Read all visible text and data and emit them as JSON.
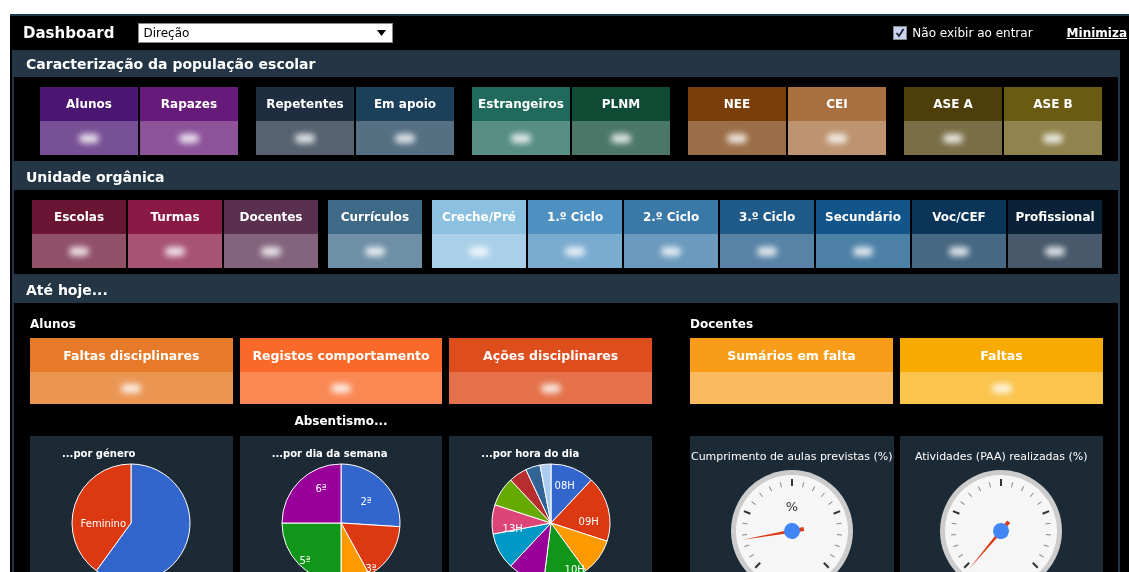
{
  "header": {
    "title": "Dashboard",
    "role_select": {
      "value": "Direção"
    },
    "hide_on_start": {
      "label": "Não exibir ao entrar",
      "checked": true
    },
    "minimize_link": "Minimiza"
  },
  "overview": {
    "title": "Caracterização da população escolar",
    "groups": [
      [
        {
          "label": "Alunos",
          "color": "#4b1572"
        },
        {
          "label": "Rapazes",
          "color": "#661a7a"
        }
      ],
      [
        {
          "label": "Repetentes",
          "color": "#1e2d40"
        },
        {
          "label": "Em apoio",
          "color": "#1c3f5a"
        }
      ],
      [
        {
          "label": "Estrangeiros",
          "color": "#1f6a5c"
        },
        {
          "label": "PLNM",
          "color": "#0f4a35"
        }
      ],
      [
        {
          "label": "NEE",
          "color": "#7a3e0a"
        },
        {
          "label": "CEI",
          "color": "#a87040"
        }
      ],
      [
        {
          "label": "ASE A",
          "color": "#4e3e0a"
        },
        {
          "label": "ASE B",
          "color": "#6b5a12"
        }
      ]
    ]
  },
  "units": {
    "title": "Unidade orgânica",
    "groups": [
      [
        {
          "label": "Escolas",
          "color": "#6b1535"
        },
        {
          "label": "Turmas",
          "color": "#8a1a45"
        },
        {
          "label": "Docentes",
          "color": "#5a3050"
        }
      ],
      [
        {
          "label": "Currículos",
          "color": "#3e6a88"
        }
      ],
      [
        {
          "label": "Creche/Pré",
          "color": "#8cc0e0"
        },
        {
          "label": "1.º Ciclo",
          "color": "#4e90c0"
        },
        {
          "label": "2.º Ciclo",
          "color": "#3a78a8"
        },
        {
          "label": "3.º Ciclo",
          "color": "#205a88"
        },
        {
          "label": "Secundário",
          "color": "#12558a"
        },
        {
          "label": "Voc/CEF",
          "color": "#0a3558"
        },
        {
          "label": "Profissional",
          "color": "#0a2238"
        }
      ]
    ]
  },
  "to_date": {
    "title": "Até hoje...",
    "students": {
      "title": "Alunos",
      "cards": [
        {
          "label": "Faltas disciplinares",
          "color": "#e67a28",
          "value_shown": true
        },
        {
          "label": "Registos comportamento",
          "color": "#f96a28",
          "value_shown": true
        },
        {
          "label": "Ações disciplinares",
          "color": "#dd4e1c",
          "value_shown": true
        }
      ],
      "absenteeism": {
        "title": "Absentismo...",
        "charts": [
          {
            "title": "...por género",
            "kind": "gender",
            "slice_labels": [
              "Feminino"
            ]
          },
          {
            "title": "...por dia da semana",
            "kind": "weekday",
            "slice_labels": [
              "2ª",
              "3ª",
              "5ª",
              "6ª"
            ]
          },
          {
            "title": "...por hora do dia",
            "kind": "hour",
            "slice_labels": [
              "08H",
              "09H",
              "10H",
              "13H"
            ]
          }
        ]
      }
    },
    "teachers": {
      "title": "Docentes",
      "cards": [
        {
          "label": "Sumários em falta",
          "color": "#f89c1a",
          "value_shown": false
        },
        {
          "label": "Faltas",
          "color": "#f8aa00",
          "value_shown": true
        }
      ],
      "gauges": [
        {
          "title": "Cumprimento de aulas previstas (%)",
          "unit": "%"
        },
        {
          "title": "Atividades (PAA) realizadas (%)"
        }
      ]
    }
  }
}
